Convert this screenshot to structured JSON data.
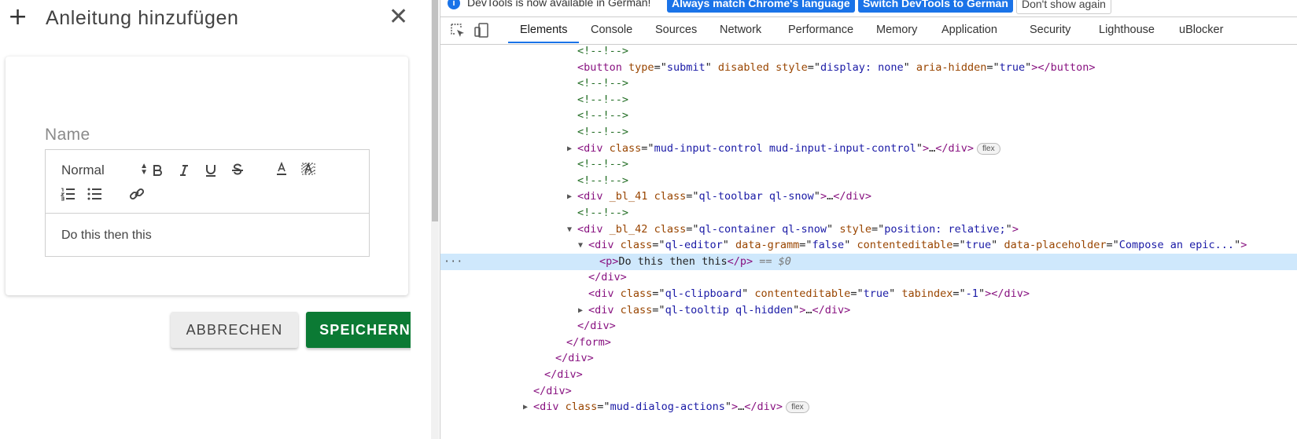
{
  "dialog": {
    "title": "Anleitung hinzufügen",
    "plus_glyph": "+",
    "close_glyph": "✕",
    "name_label": "Name",
    "editor": {
      "header_select": "Normal",
      "content": "Do this then this"
    },
    "cancel_label": "ABBRECHEN",
    "save_label": "SPEICHERN",
    "save_color": "#0b7a34"
  },
  "devtools": {
    "infobar": {
      "text": "DevTools is now available in German!",
      "btn_match": "Always match Chrome's language",
      "btn_switch": "Switch DevTools to German",
      "btn_dont": "Don't show again"
    },
    "tabs": [
      "Elements",
      "Console",
      "Sources",
      "Network",
      "Performance",
      "Memory",
      "Application",
      "Security",
      "Lighthouse",
      "uBlocker"
    ],
    "active_tab": "Elements",
    "lines": [
      {
        "comment": "<!--!-->"
      },
      {
        "tag": "button",
        "attrs": [
          [
            "type",
            "submit"
          ],
          [
            "disabled",
            null
          ],
          [
            "style",
            "display: none"
          ],
          [
            "aria-hidden",
            "true"
          ]
        ],
        "close": "</button>"
      },
      {
        "comment": "<!--!-->"
      },
      {
        "comment": "<!--!-->"
      },
      {
        "comment": "<!--!-->"
      },
      {
        "comment": "<!--!-->"
      },
      {
        "tag": "div",
        "attrs": [
          [
            "class",
            "mud-input-control mud-input-input-control"
          ]
        ],
        "ellipsis": "…",
        "close": "</div>",
        "badge": "flex",
        "collapsed": true
      },
      {
        "comment": "<!--!-->"
      },
      {
        "comment": "<!--!-->"
      },
      {
        "tag": "div",
        "attrs": [
          [
            "_bl_41",
            null
          ],
          [
            "class",
            "ql-toolbar ql-snow"
          ]
        ],
        "ellipsis": "…",
        "close": "</div>",
        "collapsed": true
      },
      {
        "comment": "<!--!-->"
      },
      {
        "tag": "div",
        "attrs": [
          [
            "_bl_42",
            null
          ],
          [
            "class",
            "ql-container ql-snow"
          ],
          [
            "style",
            "position: relative;"
          ]
        ],
        "expanded": true
      },
      {
        "tag": "div",
        "attrs": [
          [
            "class",
            "ql-editor"
          ],
          [
            "data-gramm",
            "false"
          ],
          [
            "contenteditable",
            "true"
          ],
          [
            "data-placeholder",
            "Compose an epic..."
          ]
        ],
        "expanded": true
      },
      {
        "tag": "p",
        "text": "Do this then this",
        "close": "</p>",
        "selected": true,
        "eq": "== $0"
      },
      {
        "closetag": "</div>"
      },
      {
        "tag": "div",
        "attrs": [
          [
            "class",
            "ql-clipboard"
          ],
          [
            "contenteditable",
            "true"
          ],
          [
            "tabindex",
            "-1"
          ]
        ],
        "close": "</div>"
      },
      {
        "tag": "div",
        "attrs": [
          [
            "class",
            "ql-tooltip ql-hidden"
          ]
        ],
        "ellipsis": "…",
        "close": "</div>",
        "collapsed": true
      },
      {
        "closetag": "</div>"
      },
      {
        "closetag": "</form>"
      },
      {
        "closetag": "</div>"
      },
      {
        "closetag": "</div>"
      },
      {
        "closetag": "</div>"
      },
      {
        "tag": "div",
        "attrs": [
          [
            "class",
            "mud-dialog-actions"
          ]
        ],
        "ellipsis": "…",
        "close": "</div>",
        "badge": "flex",
        "collapsed": true
      }
    ]
  }
}
